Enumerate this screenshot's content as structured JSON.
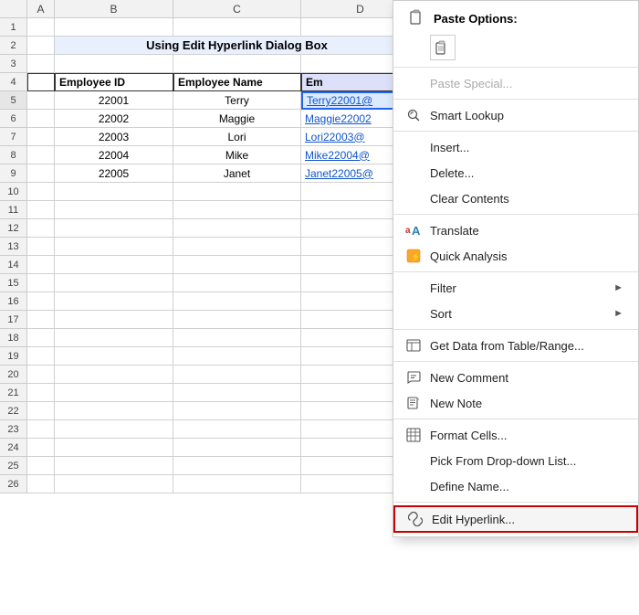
{
  "spreadsheet": {
    "title": "Using Edit Hyperlink Dialog Box",
    "columns": [
      "A",
      "B",
      "C",
      "D"
    ],
    "headers": [
      "Employee ID",
      "Employee Name",
      "Em"
    ],
    "rows": [
      {
        "id": "22001",
        "name": "Terry",
        "email": "Terry22001@"
      },
      {
        "id": "22002",
        "name": "Maggie",
        "email": "Maggie22002"
      },
      {
        "id": "22003",
        "name": "Lori",
        "email": "Lori22003@"
      },
      {
        "id": "22004",
        "name": "Mike",
        "email": "Mike22004@"
      },
      {
        "id": "22005",
        "name": "Janet",
        "email": "Janet22005@"
      }
    ]
  },
  "context_menu": {
    "paste_options_label": "Paste Options:",
    "items": [
      {
        "id": "paste-special",
        "label": "Paste Special...",
        "icon": "",
        "has_icon": false,
        "disabled": true,
        "has_arrow": false
      },
      {
        "id": "smart-lookup",
        "label": "Smart Lookup",
        "icon": "🔍",
        "has_icon": true,
        "disabled": false,
        "has_arrow": false
      },
      {
        "id": "insert",
        "label": "Insert...",
        "icon": "",
        "has_icon": false,
        "disabled": false,
        "has_arrow": false
      },
      {
        "id": "delete",
        "label": "Delete...",
        "icon": "",
        "has_icon": false,
        "disabled": false,
        "has_arrow": false
      },
      {
        "id": "clear-contents",
        "label": "Clear Contents",
        "icon": "",
        "has_icon": false,
        "disabled": false,
        "has_arrow": false
      },
      {
        "id": "translate",
        "label": "Translate",
        "icon": "aA",
        "has_icon": true,
        "disabled": false,
        "has_arrow": false
      },
      {
        "id": "quick-analysis",
        "label": "Quick Analysis",
        "icon": "⚡",
        "has_icon": true,
        "disabled": false,
        "has_arrow": false
      },
      {
        "id": "filter",
        "label": "Filter",
        "icon": "",
        "has_icon": false,
        "disabled": false,
        "has_arrow": true
      },
      {
        "id": "sort",
        "label": "Sort",
        "icon": "",
        "has_icon": false,
        "disabled": false,
        "has_arrow": true
      },
      {
        "id": "get-data",
        "label": "Get Data from Table/Range...",
        "icon": "📊",
        "has_icon": true,
        "disabled": false,
        "has_arrow": false
      },
      {
        "id": "new-comment",
        "label": "New Comment",
        "icon": "💬",
        "has_icon": true,
        "disabled": false,
        "has_arrow": false
      },
      {
        "id": "new-note",
        "label": "New Note",
        "icon": "📝",
        "has_icon": true,
        "disabled": false,
        "has_arrow": false
      },
      {
        "id": "format-cells",
        "label": "Format Cells...",
        "icon": "⊞",
        "has_icon": true,
        "disabled": false,
        "has_arrow": false
      },
      {
        "id": "pick-dropdown",
        "label": "Pick From Drop-down List...",
        "icon": "",
        "has_icon": false,
        "disabled": false,
        "has_arrow": false
      },
      {
        "id": "define-name",
        "label": "Define Name...",
        "icon": "",
        "has_icon": false,
        "disabled": false,
        "has_arrow": false
      },
      {
        "id": "edit-hyperlink",
        "label": "Edit Hyperlink...",
        "icon": "🔗",
        "has_icon": true,
        "disabled": false,
        "has_arrow": false,
        "highlighted": true
      }
    ]
  },
  "row_numbers": [
    1,
    2,
    3,
    4,
    5,
    6,
    7,
    8,
    9,
    10,
    11,
    12,
    13,
    14,
    15,
    16,
    17,
    18,
    19,
    20,
    21,
    22,
    23,
    24,
    25,
    26
  ]
}
